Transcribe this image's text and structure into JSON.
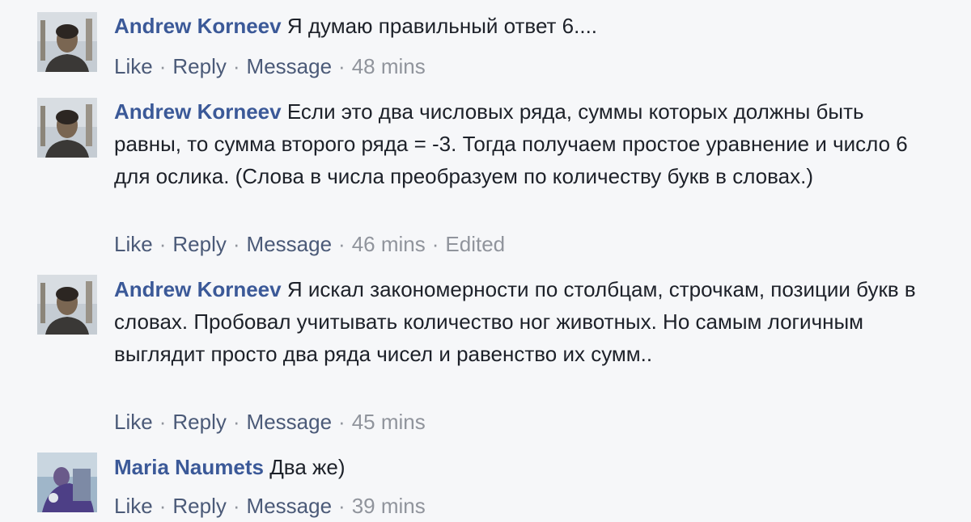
{
  "comments": [
    {
      "author": "Andrew Korneev",
      "text": "Я думаю правильный ответ 6....",
      "like": "Like",
      "reply": "Reply",
      "message": "Message",
      "time": "48 mins",
      "edited": ""
    },
    {
      "author": "Andrew Korneev",
      "text": "Если это два числовых ряда, суммы которых должны быть равны, то сумма второго ряда = -3. Тогда получаем простое уравнение и число 6 для ослика. (Слова в числа преобразуем по количеству букв в словах.)",
      "like": "Like",
      "reply": "Reply",
      "message": "Message",
      "time": "46 mins",
      "edited": "Edited"
    },
    {
      "author": "Andrew Korneev",
      "text": "Я искал закономерности по столбцам, строчкам, позиции букв в словах. Пробовал учитывать количество ног животных. Но самым логичным выглядит просто два ряда чисел и равенство их сумм..",
      "like": "Like",
      "reply": "Reply",
      "message": "Message",
      "time": "45 mins",
      "edited": ""
    },
    {
      "author": "Maria Naumets",
      "text": "Два же)",
      "like": "Like",
      "reply": "Reply",
      "message": "Message",
      "time": "39 mins",
      "edited": ""
    }
  ],
  "colors": {
    "background": "#f6f7f9",
    "author": "#3b5998",
    "text": "#1d2129",
    "meta": "#90949c",
    "action": "#4b5a78"
  }
}
